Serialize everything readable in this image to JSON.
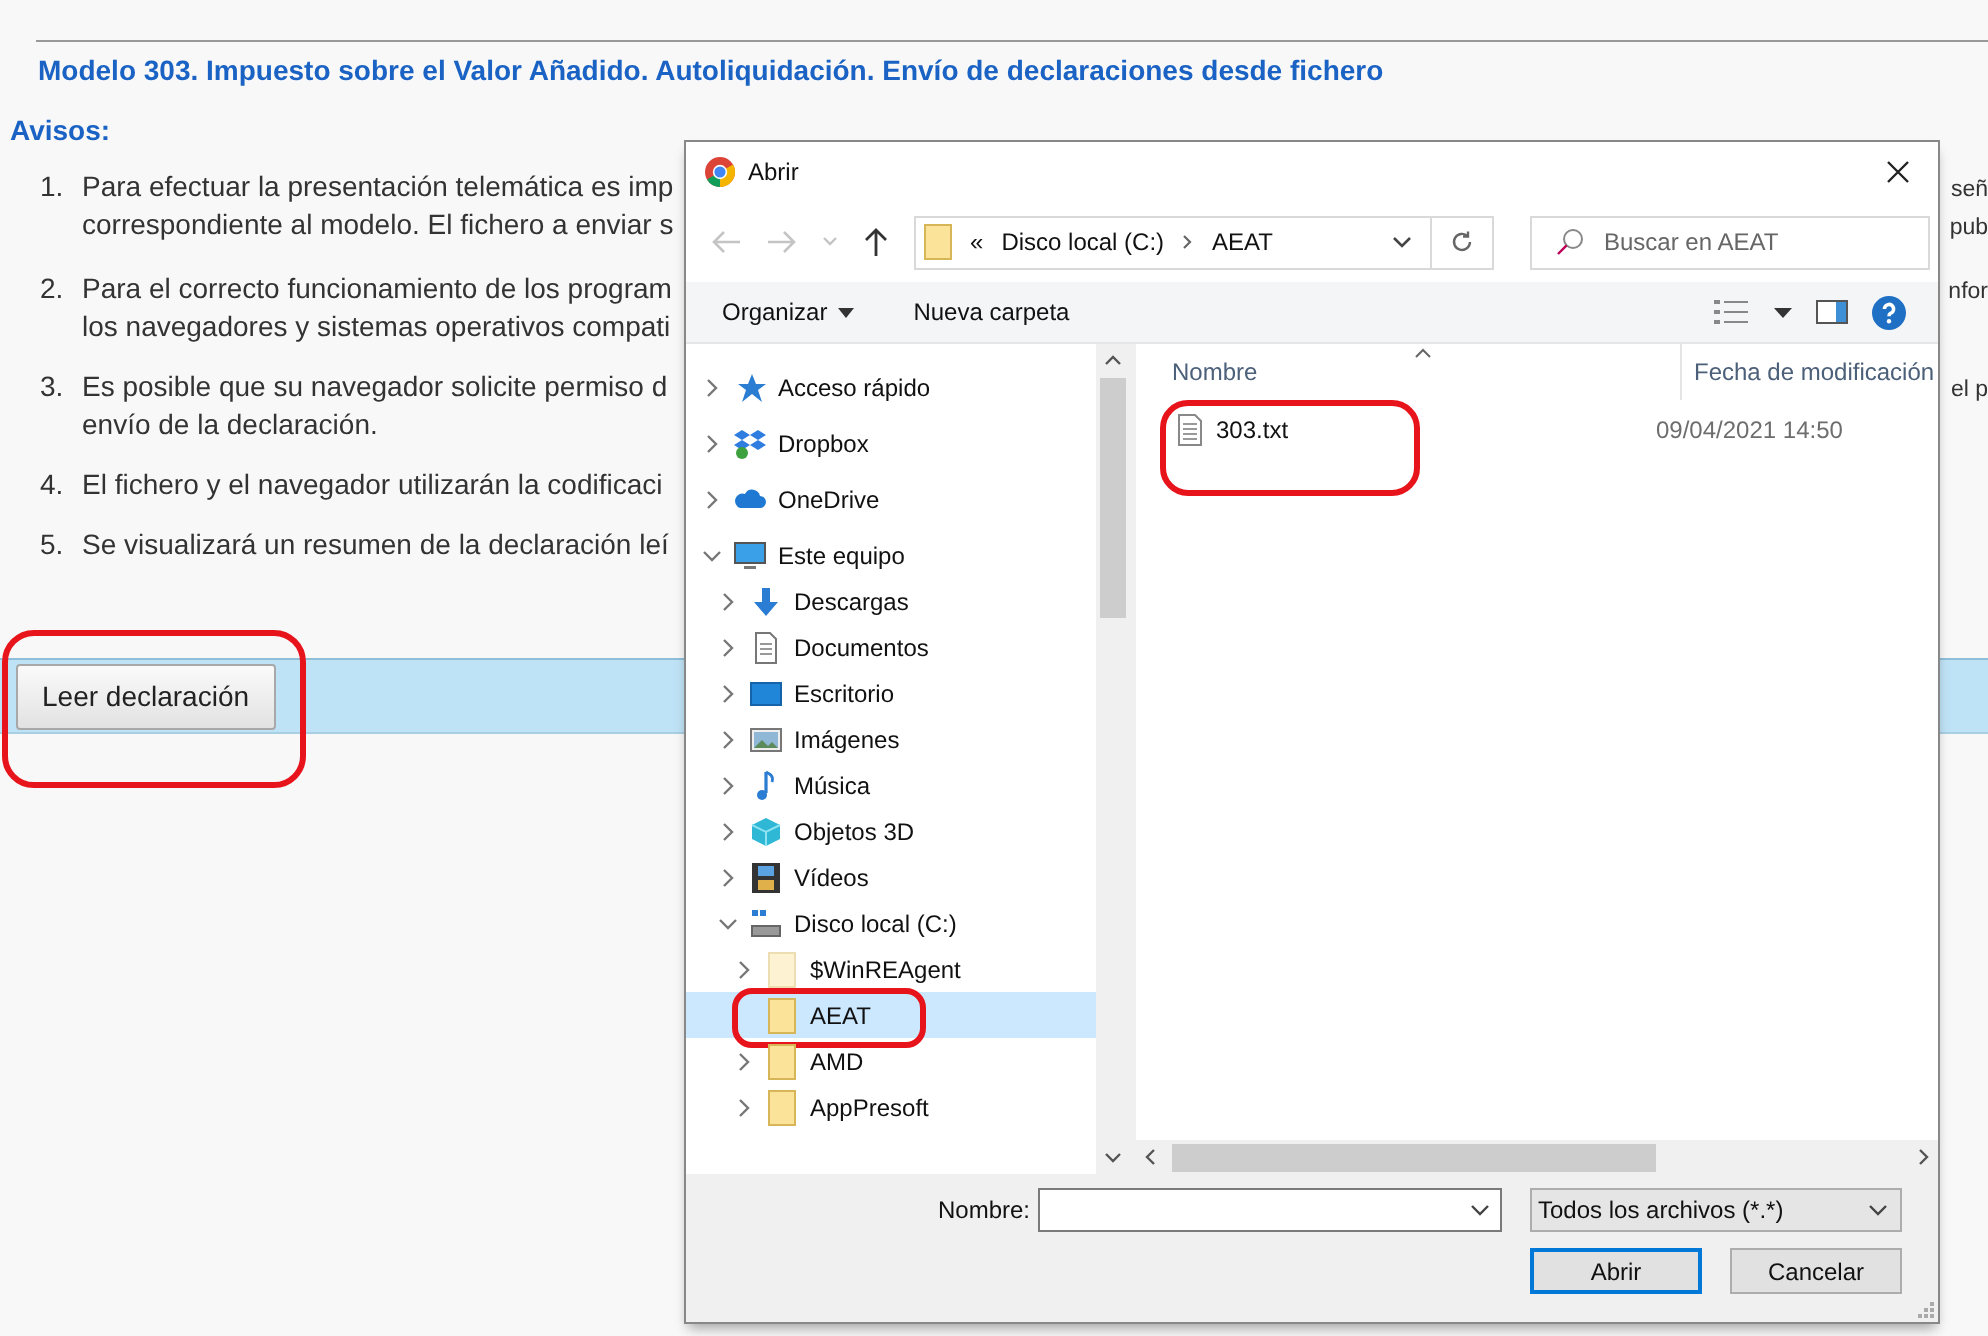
{
  "page": {
    "title": "Modelo 303. Impuesto sobre el Valor Añadido. Autoliquidación. Envío de declaraciones desde fichero",
    "notices_heading": "Avisos:",
    "notices": [
      {
        "number": "1.",
        "lines": [
          {
            "text": "Para efectuar la presentación telemática es imp",
            "tail": "señ"
          },
          {
            "text": "correspondiente al modelo. El fichero a enviar s",
            "tail": "pub"
          }
        ]
      },
      {
        "number": "2.",
        "lines": [
          {
            "text": "Para el correcto funcionamiento de los program",
            "tail": "nfor"
          },
          {
            "text": "los navegadores y sistemas operativos compati"
          }
        ]
      },
      {
        "number": "3.",
        "lines": [
          {
            "text": "Es posible que su navegador solicite permiso d",
            "tail": "el p"
          },
          {
            "text": "envío de la declaración."
          }
        ]
      },
      {
        "number": "4.",
        "lines": [
          {
            "text": "El fichero y el navegador utilizarán la codificaci"
          }
        ]
      },
      {
        "number": "5.",
        "lines": [
          {
            "text": "Se visualizará un resumen de la declaración leí"
          }
        ]
      }
    ],
    "read_button": {
      "label": "Leer declaración",
      "annotated": true
    }
  },
  "dialog": {
    "title": "Abrir",
    "address": {
      "overflow_mark": "«",
      "crumbs": [
        "Disco local (C:)",
        "AEAT"
      ]
    },
    "search": {
      "placeholder": "Buscar en AEAT"
    },
    "toolbar": {
      "organize": "Organizar",
      "new_folder": "Nueva carpeta"
    },
    "tree": [
      {
        "label": "Acceso rápido",
        "kind": "star",
        "expanded": false,
        "selected": false,
        "annotated": false
      },
      {
        "label": "Dropbox",
        "kind": "dropbox",
        "expanded": false,
        "selected": false,
        "annotated": false
      },
      {
        "label": "OneDrive",
        "kind": "cloud",
        "expanded": false,
        "selected": false,
        "annotated": false
      },
      {
        "label": "Este equipo",
        "kind": "monitor",
        "expanded": true,
        "selected": false,
        "annotated": false,
        "children": [
          {
            "label": "Descargas",
            "kind": "download",
            "expanded": false,
            "selected": false,
            "annotated": false
          },
          {
            "label": "Documentos",
            "kind": "document",
            "expanded": false,
            "selected": false,
            "annotated": false
          },
          {
            "label": "Escritorio",
            "kind": "desktop",
            "expanded": false,
            "selected": false,
            "annotated": false
          },
          {
            "label": "Imágenes",
            "kind": "picture",
            "expanded": false,
            "selected": false,
            "annotated": false
          },
          {
            "label": "Música",
            "kind": "music",
            "expanded": false,
            "selected": false,
            "annotated": false
          },
          {
            "label": "Objetos 3D",
            "kind": "cube",
            "expanded": false,
            "selected": false,
            "annotated": false
          },
          {
            "label": "Vídeos",
            "kind": "film",
            "expanded": false,
            "selected": false,
            "annotated": false
          },
          {
            "label": "Disco local (C:)",
            "kind": "drive",
            "expanded": true,
            "selected": false,
            "annotated": false,
            "children": [
              {
                "label": "$WinREAgent",
                "kind": "folder",
                "expanded": false,
                "selected": false,
                "annotated": false,
                "hidden": true,
                "has_children": true
              },
              {
                "label": "AEAT",
                "kind": "folder",
                "expanded": false,
                "selected": true,
                "annotated": true,
                "hidden": false,
                "has_children": false
              },
              {
                "label": "AMD",
                "kind": "folder",
                "expanded": false,
                "selected": false,
                "annotated": false,
                "hidden": false,
                "has_children": true
              },
              {
                "label": "AppPresoft",
                "kind": "folder",
                "expanded": false,
                "selected": false,
                "annotated": false,
                "hidden": false,
                "has_children": true
              }
            ]
          }
        ]
      }
    ],
    "columns": [
      "Nombre",
      "Fecha de modificación"
    ],
    "files": [
      {
        "name": "303.txt",
        "modified": "09/04/2021 14:50",
        "annotated": true
      }
    ],
    "filename": {
      "label": "Nombre:"
    },
    "file_type": "Todos los archivos (*.*)",
    "buttons": [
      {
        "label": "Abrir",
        "default": true
      },
      {
        "label": "Cancelar",
        "default": false
      }
    ]
  }
}
